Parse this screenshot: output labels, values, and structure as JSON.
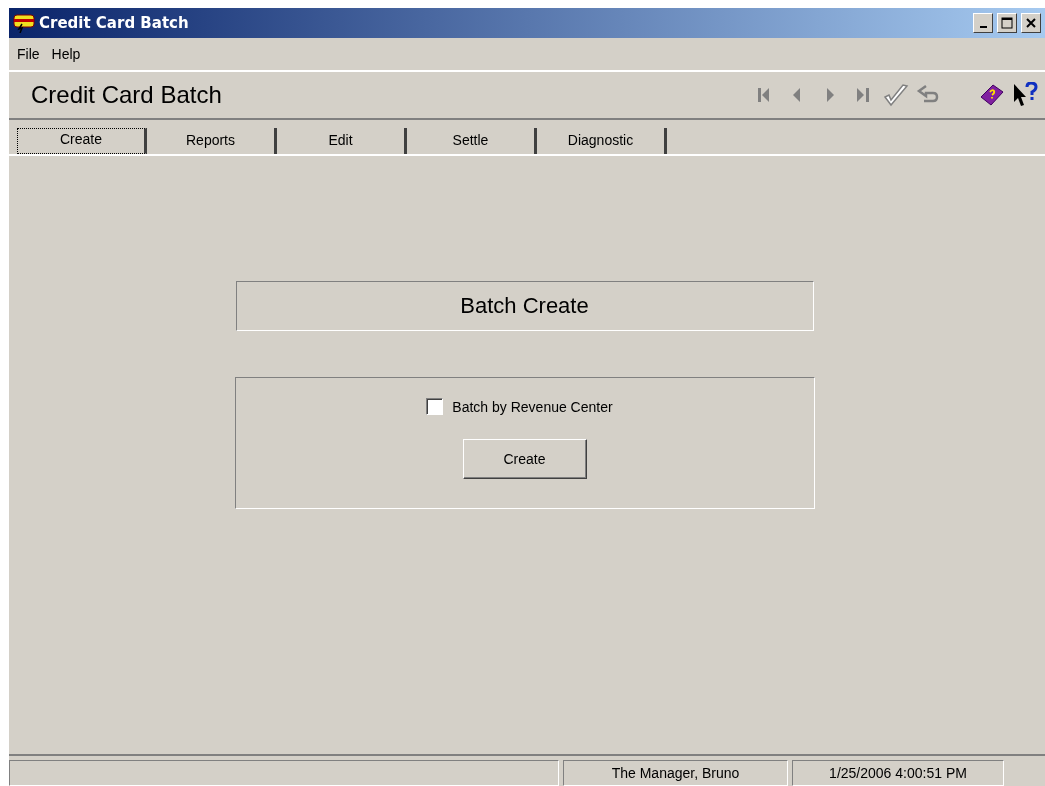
{
  "window": {
    "title": "Credit Card Batch"
  },
  "menu": [
    "File",
    "Help"
  ],
  "header": {
    "title": "Credit Card Batch"
  },
  "toolbar": [
    {
      "kind": "first",
      "disabled": true
    },
    {
      "kind": "prev",
      "disabled": true
    },
    {
      "kind": "next",
      "disabled": true
    },
    {
      "kind": "last",
      "disabled": true
    },
    {
      "kind": "check",
      "disabled": true
    },
    {
      "kind": "undo",
      "disabled": true
    },
    {
      "kind": "help-book",
      "disabled": false
    },
    {
      "kind": "whats-this",
      "disabled": false
    }
  ],
  "tabs": [
    {
      "label": "Create",
      "selected": true
    },
    {
      "label": "Reports",
      "selected": false
    },
    {
      "label": "Edit",
      "selected": false
    },
    {
      "label": "Settle",
      "selected": false
    },
    {
      "label": "Diagnostic",
      "selected": false
    }
  ],
  "panel": {
    "heading": "Batch Create",
    "checkbox": {
      "label": "Batch by Revenue Center",
      "checked": false
    },
    "button": "Create"
  },
  "status_bar": {
    "user": "The Manager, Bruno",
    "datetime": "1/25/2006 4:00:51 PM"
  }
}
